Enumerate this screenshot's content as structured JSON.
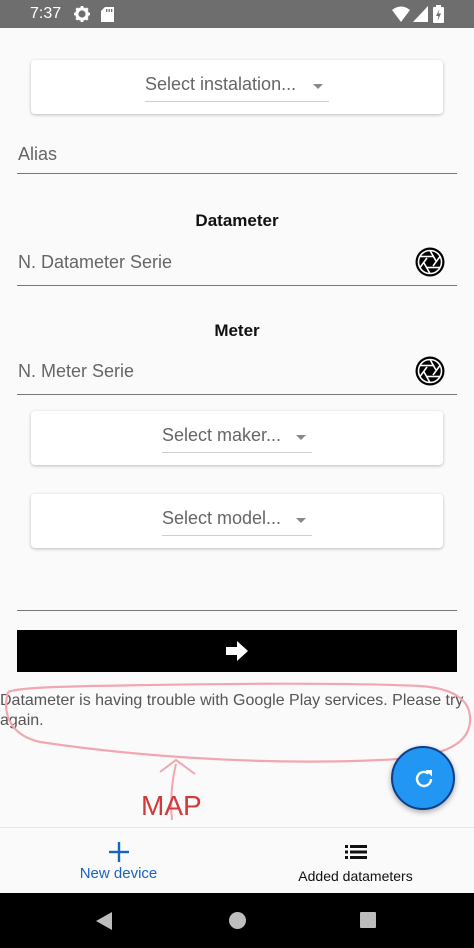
{
  "status_bar": {
    "time": "7:37",
    "icons": [
      "gear-icon",
      "sd-card-icon",
      "wifi-icon",
      "signal-icon",
      "battery-icon"
    ]
  },
  "form": {
    "installation_select": "Select instalation...",
    "alias_placeholder": "Alias",
    "datameter_title": "Datameter",
    "datameter_serie_placeholder": "N. Datameter Serie",
    "meter_title": "Meter",
    "meter_serie_placeholder": "N. Meter Serie",
    "maker_select": "Select maker...",
    "model_select": "Select model..."
  },
  "error_message": "Datameter is having trouble with Google Play services. Please try again.",
  "annotation": {
    "label": "MAP",
    "color": "#d13a3a"
  },
  "fab": {
    "icon": "refresh-icon",
    "color": "#2196f3"
  },
  "bottom_nav": {
    "items": [
      {
        "label": "New device",
        "icon": "plus-icon"
      },
      {
        "label": "Added datameters",
        "icon": "list-icon"
      }
    ],
    "accent": "#1565c0"
  },
  "system_nav": {
    "icons": [
      "back-icon",
      "home-icon",
      "recents-icon"
    ]
  }
}
